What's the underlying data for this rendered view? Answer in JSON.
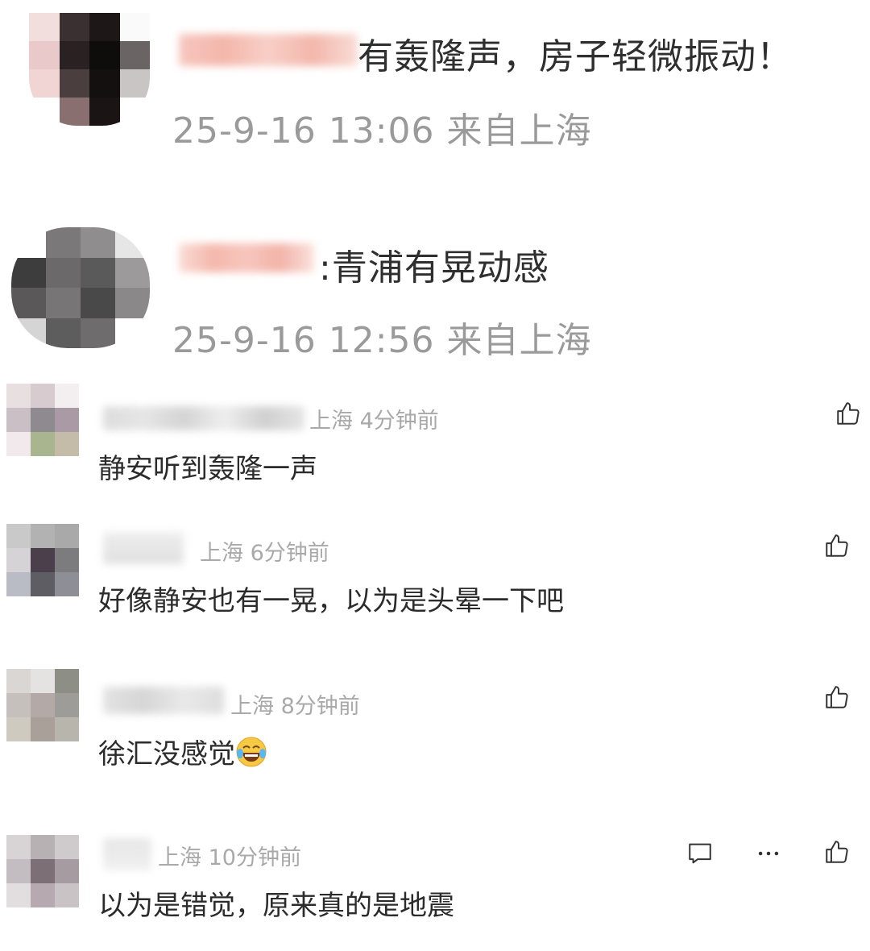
{
  "posts": [
    {
      "text": "有轰隆声，房子轻微振动！",
      "meta": "25-9-16 13:06 来自上海"
    },
    {
      "text": ":青浦有晃动感",
      "meta": "25-9-16 12:56 来自上海"
    }
  ],
  "comments": [
    {
      "meta": "上海 4分钟前",
      "text": "静安听到轰隆一声"
    },
    {
      "meta": "上海 6分钟前",
      "text": "好像静安也有一晃，以为是头晕一下吧"
    },
    {
      "meta": "上海 8分钟前",
      "text": "徐汇没感觉"
    },
    {
      "meta": "上海 10分钟前",
      "text": "以为是错觉，原来真的是地震"
    }
  ],
  "icons": {
    "like": "thumbs-up-icon",
    "reply": "comment-bubble-icon",
    "more": "more-dots-icon",
    "emoji": "laughing-crying-emoji"
  }
}
